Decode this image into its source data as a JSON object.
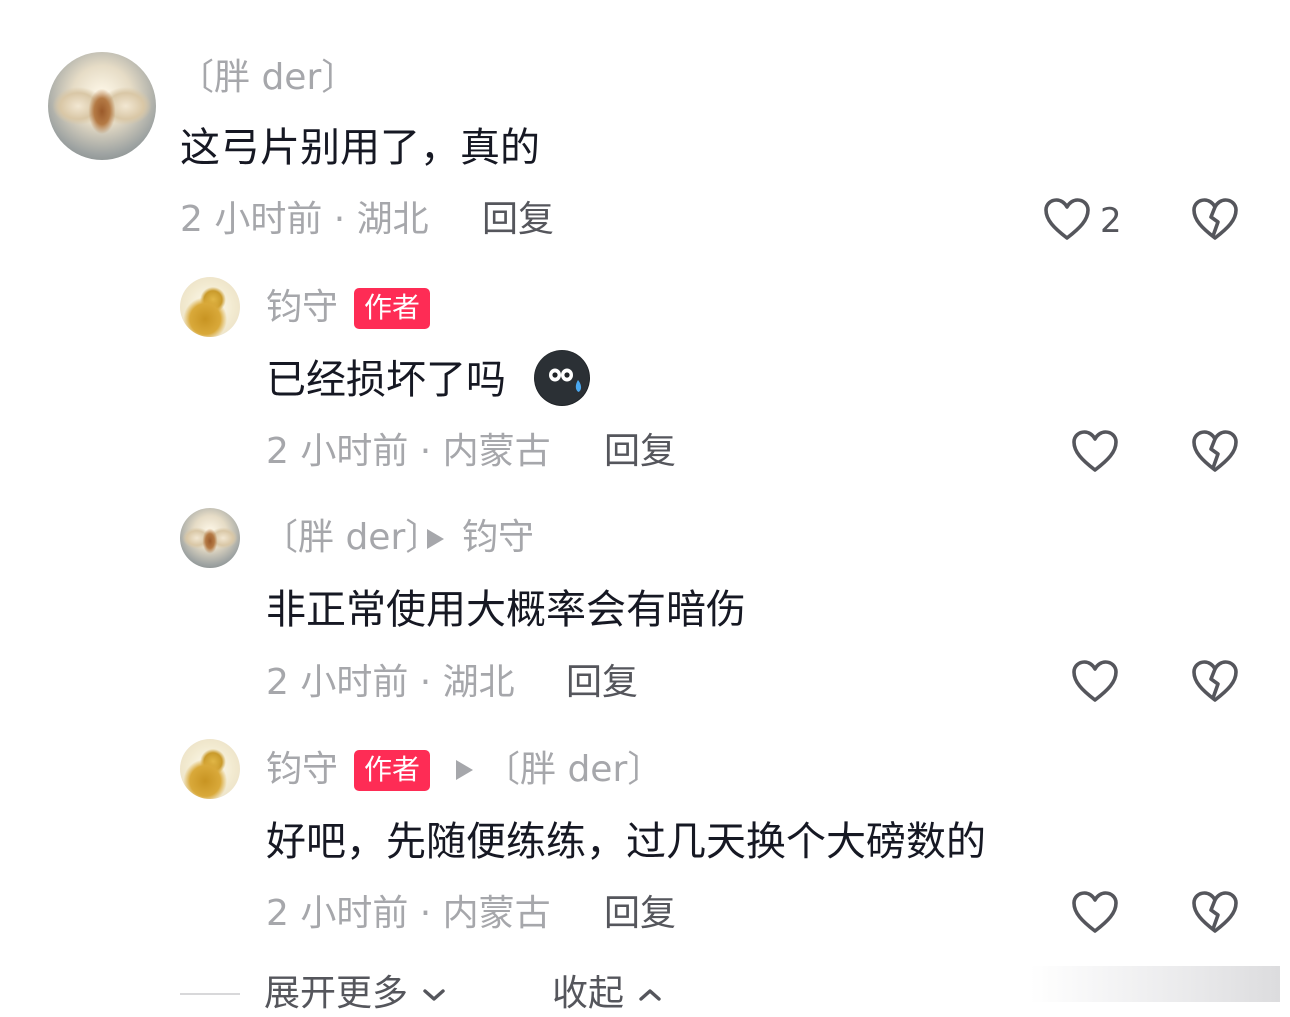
{
  "comments": [
    {
      "username": "〔胖 der〕",
      "text": "这弓片别用了，真的",
      "meta": "2 小时前 · 湖北",
      "reply_label": "回复",
      "like_count": "2",
      "avatar": "angel-avatar"
    },
    {
      "username": "钧守",
      "badge": "作者",
      "text": "已经损坏了吗",
      "emoji": "sweat-face-emoji",
      "meta": "2 小时前 · 内蒙古",
      "reply_label": "回复",
      "avatar": "gourd-avatar"
    },
    {
      "username": "〔胖 der〕",
      "reply_to": "钧守",
      "text": "非正常使用大概率会有暗伤",
      "meta": "2 小时前 · 湖北",
      "reply_label": "回复",
      "avatar": "angel-avatar"
    },
    {
      "username": "钧守",
      "badge": "作者",
      "reply_to": "〔胖 der〕",
      "text": "好吧，先随便练练，过几天换个大磅数的",
      "meta": "2 小时前 · 内蒙古",
      "reply_label": "回复",
      "avatar": "gourd-avatar"
    }
  ],
  "footer": {
    "expand_label": "展开更多",
    "collapse_label": "收起"
  },
  "colors": {
    "badge": "#fe2c55",
    "secondary_text": "#a6a7ab",
    "action_text": "#55565c",
    "primary_text": "#161823"
  },
  "icons": [
    "heart-outline-icon",
    "broken-heart-icon",
    "chevron-down-icon",
    "chevron-up-icon",
    "reply-arrow-icon"
  ]
}
